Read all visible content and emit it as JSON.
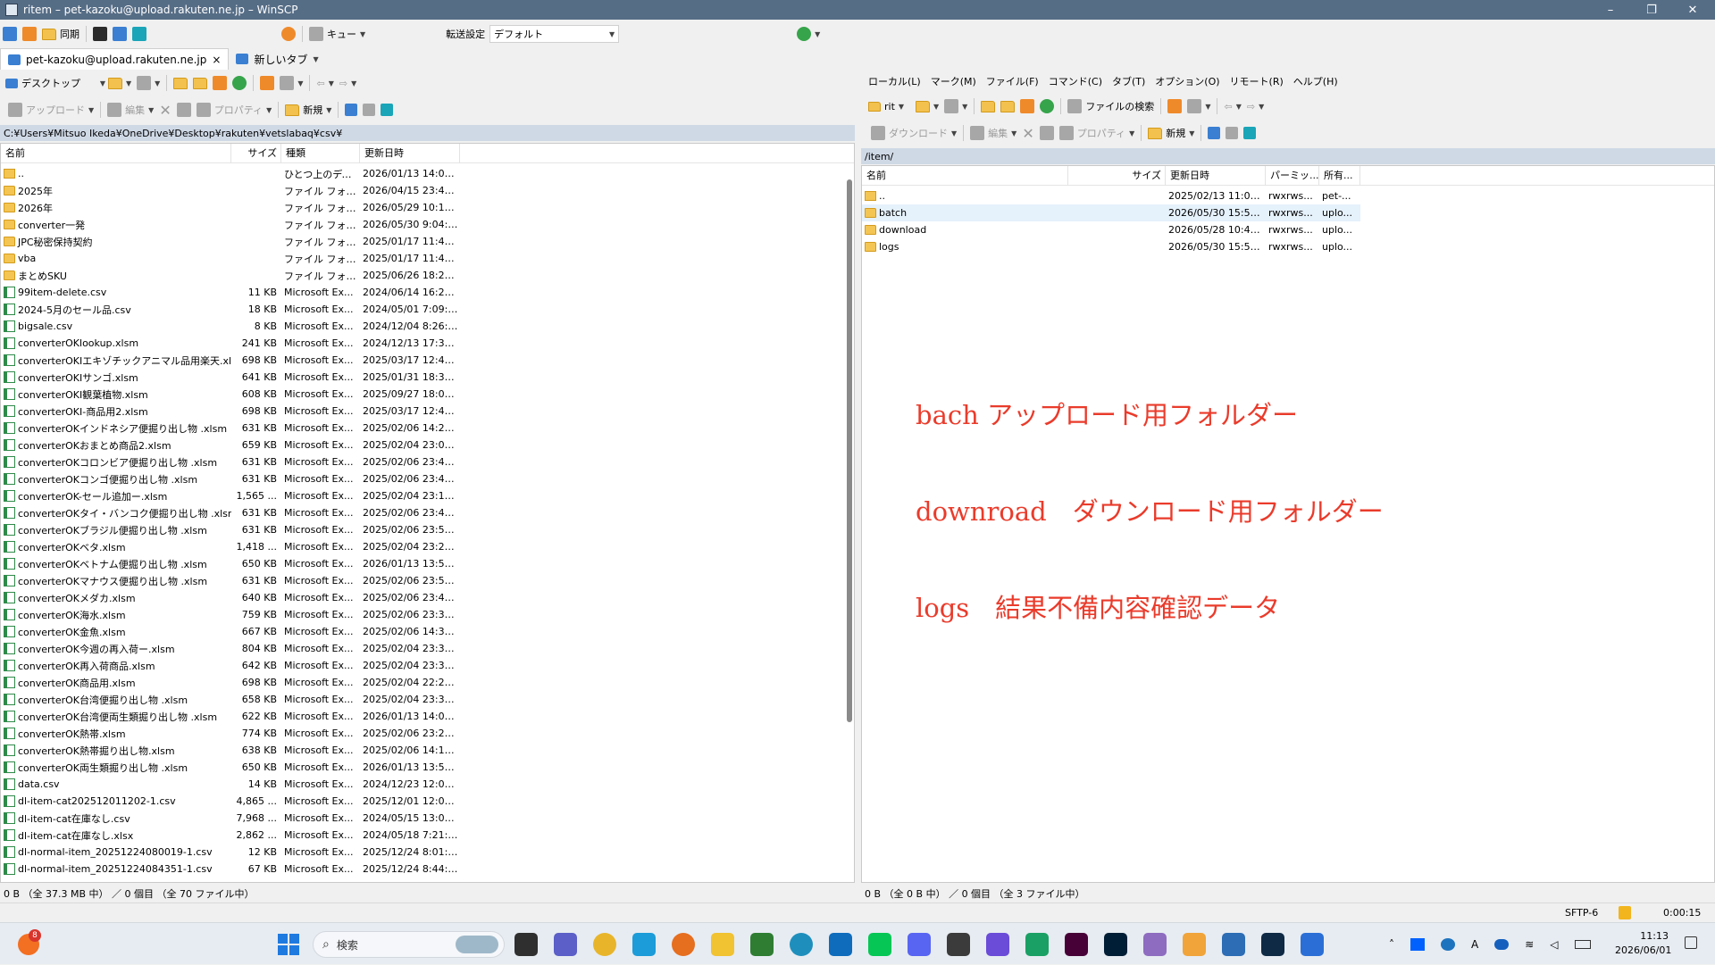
{
  "window": {
    "title": "ritem – pet-kazoku@upload.rakuten.ne.jp – WinSCP"
  },
  "toolbar": {
    "sync_label": "同期",
    "queue_label": "キュー",
    "transfer_settings_label": "転送設定",
    "transfer_settings_value": "デフォルト"
  },
  "tabs": [
    {
      "label": "pet-kazoku@upload.rakuten.ne.jp",
      "close": "×"
    },
    {
      "label": "新しいタブ"
    }
  ],
  "local": {
    "location": "デスクトップ",
    "toolbar": {
      "upload": "アップロード",
      "edit": "編集",
      "properties": "プロパティ",
      "new": "新規"
    },
    "path": "C:¥Users¥Mitsuo Ikeda¥OneDrive¥Desktop¥rakuten¥vetslabaq¥csv¥",
    "columns": {
      "name": "名前",
      "size": "サイズ",
      "type": "種類",
      "modified": "更新日時"
    },
    "status": "0 B （全 37.3 MB 中） ／ 0 個目 （全 70 ファイル中）",
    "files": [
      {
        "icon": "up",
        "name": "..",
        "size": "",
        "type": "ひとつ上のディ...",
        "modified": "2026/01/13 14:02:..."
      },
      {
        "icon": "folder",
        "name": "2025年",
        "size": "",
        "type": "ファイル フォル...",
        "modified": "2026/04/15 23:46:..."
      },
      {
        "icon": "folder",
        "name": "2026年",
        "size": "",
        "type": "ファイル フォル...",
        "modified": "2026/05/29 10:10:..."
      },
      {
        "icon": "folder",
        "name": "converter一発",
        "size": "",
        "type": "ファイル フォル...",
        "modified": "2026/05/30 9:04:21"
      },
      {
        "icon": "folder",
        "name": "JPC秘密保持契約",
        "size": "",
        "type": "ファイル フォル...",
        "modified": "2025/01/17 11:42:..."
      },
      {
        "icon": "folder",
        "name": "vba",
        "size": "",
        "type": "ファイル フォル...",
        "modified": "2025/01/17 11:42:..."
      },
      {
        "icon": "folder",
        "name": "まとめSKU",
        "size": "",
        "type": "ファイル フォル...",
        "modified": "2025/06/26 18:29:..."
      },
      {
        "icon": "file",
        "name": "99item-delete.csv",
        "size": "11 KB",
        "type": "Microsoft Ex...",
        "modified": "2024/06/14 16:21:..."
      },
      {
        "icon": "file",
        "name": "2024-5月のセール品.csv",
        "size": "18 KB",
        "type": "Microsoft Ex...",
        "modified": "2024/05/01 7:09:24"
      },
      {
        "icon": "file",
        "name": "bigsale.csv",
        "size": "8 KB",
        "type": "Microsoft Ex...",
        "modified": "2024/12/04 8:26:04"
      },
      {
        "icon": "file",
        "name": "converterOKlookup.xlsm",
        "size": "241 KB",
        "type": "Microsoft Ex...",
        "modified": "2024/12/13 17:34:..."
      },
      {
        "icon": "file",
        "name": "converterOKIエキゾチックアニマル品用楽天.xl...",
        "size": "698 KB",
        "type": "Microsoft Ex...",
        "modified": "2025/03/17 12:43:..."
      },
      {
        "icon": "file",
        "name": "converterOKIサンゴ.xlsm",
        "size": "641 KB",
        "type": "Microsoft Ex...",
        "modified": "2025/01/31 18:30:..."
      },
      {
        "icon": "file",
        "name": "converterOKI観葉植物.xlsm",
        "size": "608 KB",
        "type": "Microsoft Ex...",
        "modified": "2025/09/27 18:09:..."
      },
      {
        "icon": "file",
        "name": "converterOKI-商品用2.xlsm",
        "size": "698 KB",
        "type": "Microsoft Ex...",
        "modified": "2025/03/17 12:42:..."
      },
      {
        "icon": "file",
        "name": "converterOKインドネシア便掘り出し物 .xlsm",
        "size": "631 KB",
        "type": "Microsoft Ex...",
        "modified": "2025/02/06 14:26:..."
      },
      {
        "icon": "file",
        "name": "converterOKおまとめ商品2.xlsm",
        "size": "659 KB",
        "type": "Microsoft Ex...",
        "modified": "2025/02/04 23:09:..."
      },
      {
        "icon": "file",
        "name": "converterOKコロンビア便掘り出し物 .xlsm",
        "size": "631 KB",
        "type": "Microsoft Ex...",
        "modified": "2025/02/06 23:45:..."
      },
      {
        "icon": "file",
        "name": "converterOKコンゴ便掘り出し物 .xlsm",
        "size": "631 KB",
        "type": "Microsoft Ex...",
        "modified": "2025/02/06 23:46:..."
      },
      {
        "icon": "file",
        "name": "converterOK-セール追加ー.xlsm",
        "size": "1,565 ...",
        "type": "Microsoft Ex...",
        "modified": "2025/02/04 23:17:..."
      },
      {
        "icon": "file",
        "name": "converterOKタイ・バンコク便掘り出し物 .xlsm",
        "size": "631 KB",
        "type": "Microsoft Ex...",
        "modified": "2025/02/06 23:49:..."
      },
      {
        "icon": "file",
        "name": "converterOKブラジル便掘り出し物 .xlsm",
        "size": "631 KB",
        "type": "Microsoft Ex...",
        "modified": "2025/02/06 23:51:..."
      },
      {
        "icon": "file",
        "name": "converterOKベタ.xlsm",
        "size": "1,418 ...",
        "type": "Microsoft Ex...",
        "modified": "2025/02/04 23:22:..."
      },
      {
        "icon": "file",
        "name": "converterOKベトナム便掘り出し物 .xlsm",
        "size": "650 KB",
        "type": "Microsoft Ex...",
        "modified": "2026/01/13 13:56:..."
      },
      {
        "icon": "file",
        "name": "converterOKマナウス便掘り出し物 .xlsm",
        "size": "631 KB",
        "type": "Microsoft Ex...",
        "modified": "2025/02/06 23:53:..."
      },
      {
        "icon": "file",
        "name": "converterOKメダカ.xlsm",
        "size": "640 KB",
        "type": "Microsoft Ex...",
        "modified": "2025/02/06 23:43:..."
      },
      {
        "icon": "file",
        "name": "converterOK海水.xlsm",
        "size": "759 KB",
        "type": "Microsoft Ex...",
        "modified": "2025/02/06 23:30:..."
      },
      {
        "icon": "file",
        "name": "converterOK金魚.xlsm",
        "size": "667 KB",
        "type": "Microsoft Ex...",
        "modified": "2025/02/06 14:38:..."
      },
      {
        "icon": "file",
        "name": "converterOK今週の再入荷ー.xlsm",
        "size": "804 KB",
        "type": "Microsoft Ex...",
        "modified": "2025/02/04 23:30:..."
      },
      {
        "icon": "file",
        "name": "converterOK再入荷商品.xlsm",
        "size": "642 KB",
        "type": "Microsoft Ex...",
        "modified": "2025/02/04 23:32:..."
      },
      {
        "icon": "file",
        "name": "converterOK商品用.xlsm",
        "size": "698 KB",
        "type": "Microsoft Ex...",
        "modified": "2025/02/04 22:24:..."
      },
      {
        "icon": "file",
        "name": "converterOK台湾便掘り出し物 .xlsm",
        "size": "658 KB",
        "type": "Microsoft Ex...",
        "modified": "2025/02/04 23:34:..."
      },
      {
        "icon": "file",
        "name": "converterOK台湾便両生類掘り出し物 .xlsm",
        "size": "622 KB",
        "type": "Microsoft Ex...",
        "modified": "2026/01/13 14:02:..."
      },
      {
        "icon": "file",
        "name": "converterOK熱帯.xlsm",
        "size": "774 KB",
        "type": "Microsoft Ex...",
        "modified": "2025/02/06 23:22:..."
      },
      {
        "icon": "file",
        "name": "converterOK熱帯掘り出し物.xlsm",
        "size": "638 KB",
        "type": "Microsoft Ex...",
        "modified": "2025/02/06 14:14:..."
      },
      {
        "icon": "file",
        "name": "converterOK両生類掘り出し物 .xlsm",
        "size": "650 KB",
        "type": "Microsoft Ex...",
        "modified": "2026/01/13 13:57:..."
      },
      {
        "icon": "file",
        "name": "data.csv",
        "size": "14 KB",
        "type": "Microsoft Ex...",
        "modified": "2024/12/23 12:06:..."
      },
      {
        "icon": "file",
        "name": "dl-item-cat202512011202-1.csv",
        "size": "4,865 ...",
        "type": "Microsoft Ex...",
        "modified": "2025/12/01 12:06:..."
      },
      {
        "icon": "file",
        "name": "dl-item-cat在庫なし.csv",
        "size": "7,968 ...",
        "type": "Microsoft Ex...",
        "modified": "2024/05/15 13:05:..."
      },
      {
        "icon": "file",
        "name": "dl-item-cat在庫なし.xlsx",
        "size": "2,862 ...",
        "type": "Microsoft Ex...",
        "modified": "2024/05/18 7:21:51"
      },
      {
        "icon": "file",
        "name": "dl-normal-item_20251224080019-1.csv",
        "size": "12 KB",
        "type": "Microsoft Ex...",
        "modified": "2025/12/24 8:01:03"
      },
      {
        "icon": "file",
        "name": "dl-normal-item_20251224084351-1.csv",
        "size": "67 KB",
        "type": "Microsoft Ex...",
        "modified": "2025/12/24 8:44:05"
      }
    ]
  },
  "remote": {
    "menu": [
      "ローカル(L)",
      "マーク(M)",
      "ファイル(F)",
      "コマンド(C)",
      "タブ(T)",
      "オプション(O)",
      "リモート(R)",
      "ヘルプ(H)"
    ],
    "location": "rit",
    "find_files": "ファイルの検索",
    "toolbar": {
      "download": "ダウンロード",
      "edit": "編集",
      "properties": "プロパティ",
      "new": "新規"
    },
    "path": "/item/",
    "columns": {
      "name": "名前",
      "size": "サイズ",
      "modified": "更新日時",
      "perms": "パーミッ...",
      "owner": "所有..."
    },
    "status": "0 B （全 0 B 中） ／ 0 個目 （全 3 ファイル中）",
    "files": [
      {
        "icon": "up",
        "name": "..",
        "size": "",
        "modified": "2025/02/13 11:07:...",
        "perms": "rwxrws...",
        "owner": "pet-..."
      },
      {
        "icon": "folder",
        "name": "batch",
        "size": "",
        "modified": "2026/05/30 15:59:...",
        "perms": "rwxrws...",
        "owner": "uplo..."
      },
      {
        "icon": "folder",
        "name": "download",
        "size": "",
        "modified": "2026/05/28 10:40:...",
        "perms": "rwxrws...",
        "owner": "uplo..."
      },
      {
        "icon": "folder",
        "name": "logs",
        "size": "",
        "modified": "2026/05/30 15:52:...",
        "perms": "rwxrws...",
        "owner": "uplo..."
      }
    ]
  },
  "annotation": {
    "lines": [
      "bach アップロード用フォルダー",
      "downroad　ダウンロード用フォルダー",
      "logs　結果不備内容確認データ"
    ],
    "color": "#ea3b2b"
  },
  "bottom_status": {
    "protocol": "SFTP-6",
    "elapsed": "0:00:15"
  },
  "taskbar": {
    "search_placeholder": "検索",
    "notification_badge": "8",
    "time": "11:13",
    "date": "2026/06/01"
  }
}
